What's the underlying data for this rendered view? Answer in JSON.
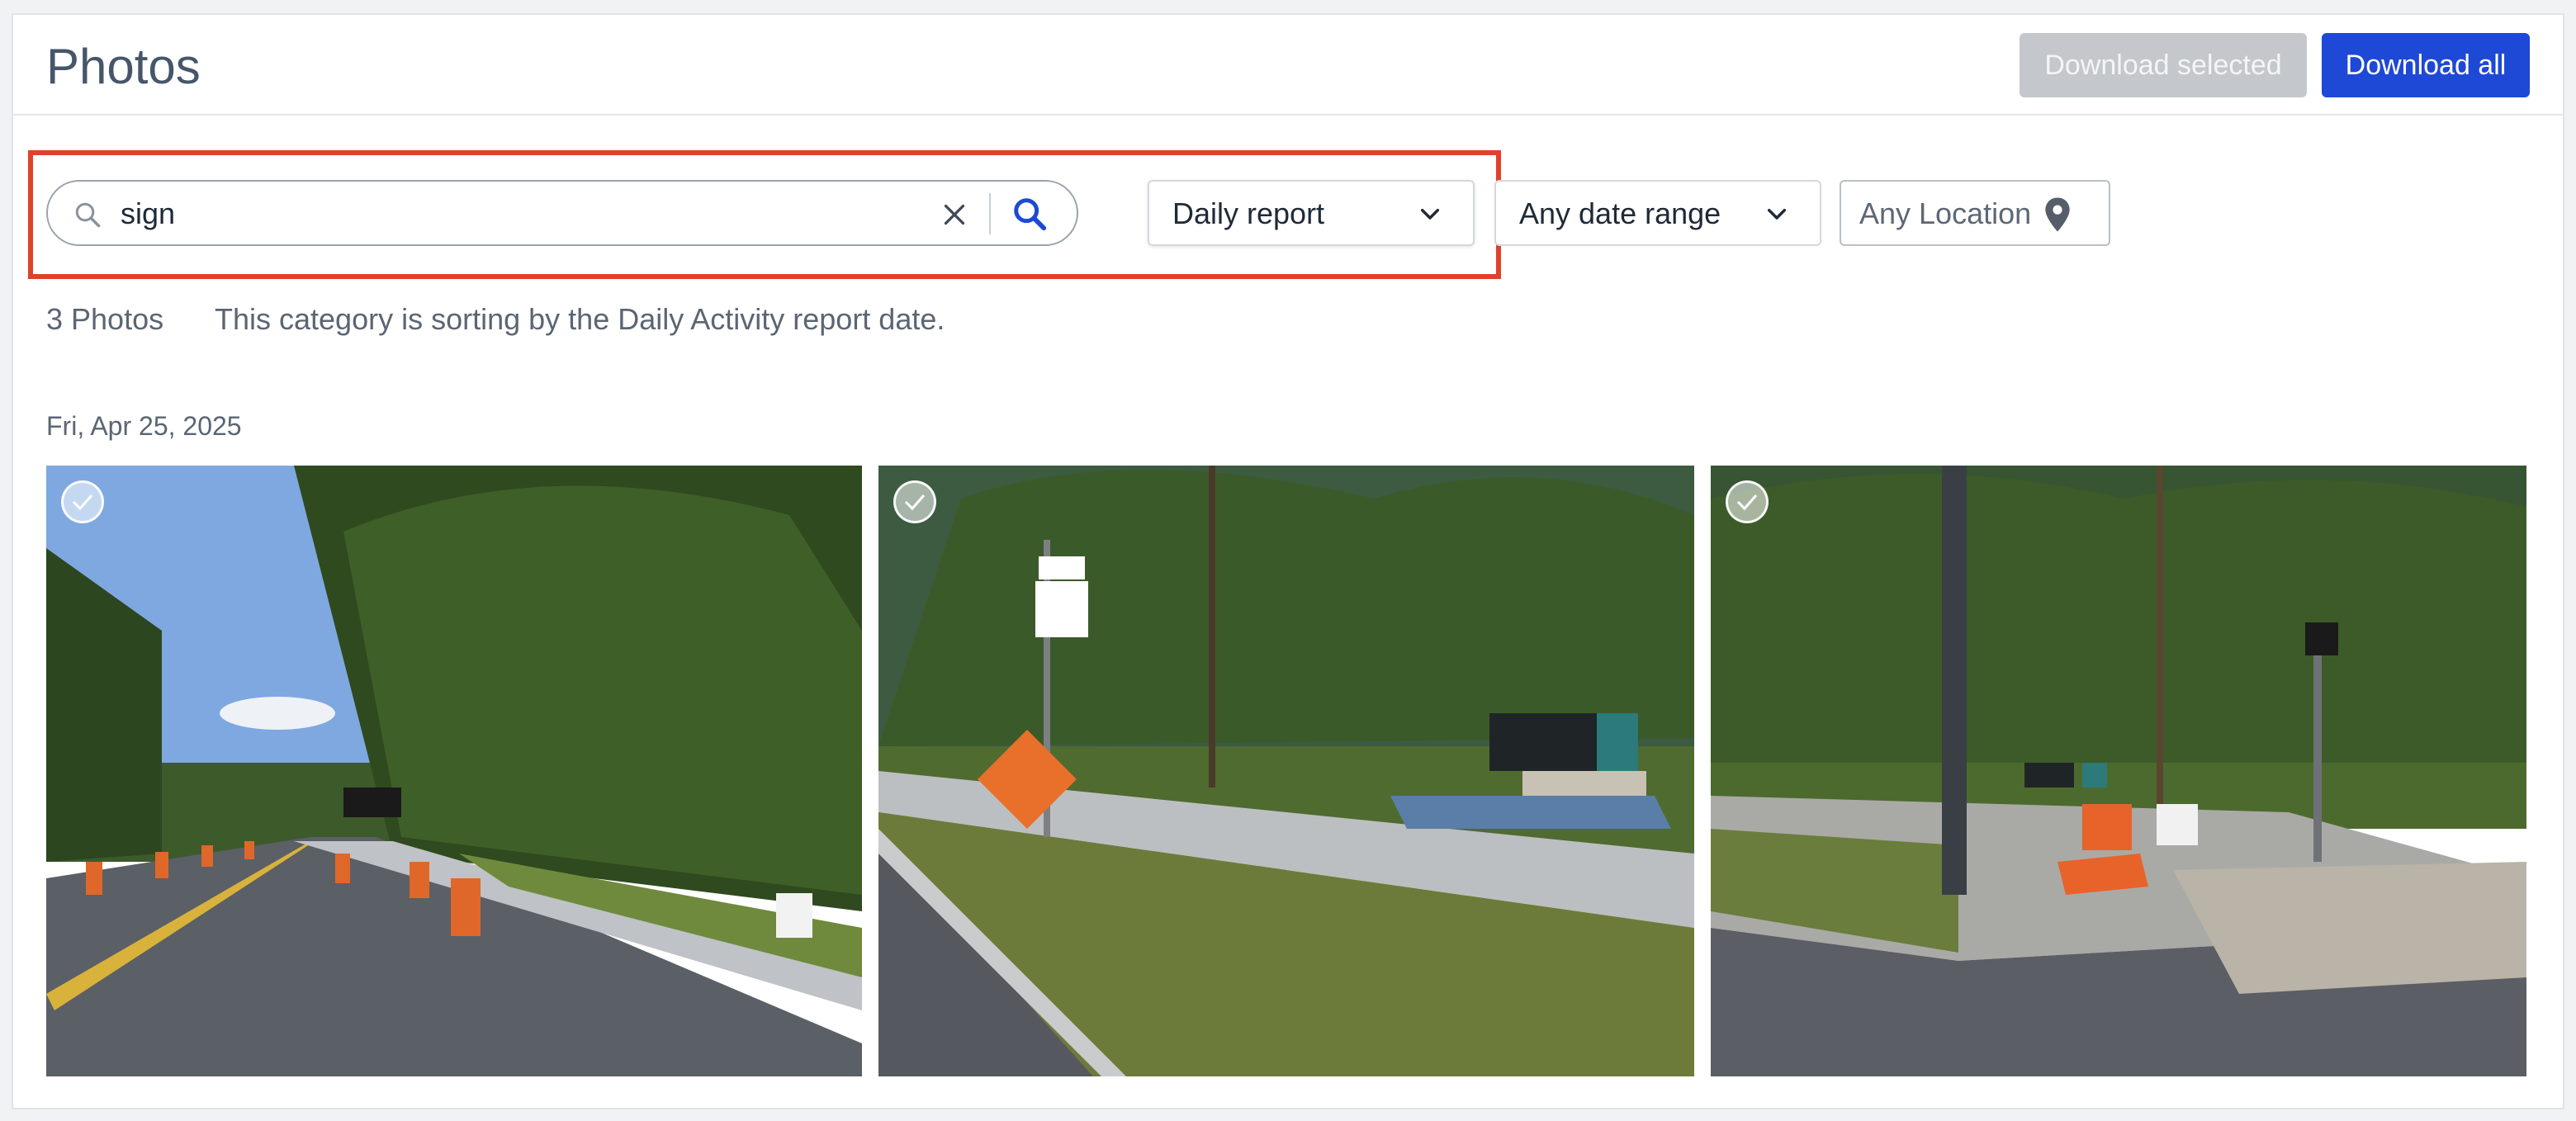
{
  "header": {
    "title": "Photos",
    "download_selected_label": "Download selected",
    "download_all_label": "Download all"
  },
  "filters": {
    "search": {
      "value": "sign",
      "icon": "search-icon",
      "clear_icon": "close-icon",
      "submit_icon": "search-icon"
    },
    "category": {
      "selected": "Daily report",
      "icon": "chevron-down-icon"
    },
    "date_range": {
      "selected": "Any date range",
      "icon": "chevron-down-icon"
    },
    "location": {
      "selected": "Any Location",
      "icon": "map-pin-icon"
    }
  },
  "summary": {
    "count": "3 Photos",
    "note": "This category is sorting by the Daily Activity report date."
  },
  "groups": [
    {
      "date": "Fri, Apr 25, 2025",
      "photos": [
        {
          "description_icon": "roadwork-cones-photo"
        },
        {
          "description_icon": "road-work-ahead-sign-photo"
        },
        {
          "description_icon": "detour-sign-photo"
        }
      ]
    }
  ],
  "colors": {
    "accent": "#1e48d6",
    "disabled": "#c4c8cc",
    "highlight": "#e0412b",
    "text": "#46566a"
  }
}
